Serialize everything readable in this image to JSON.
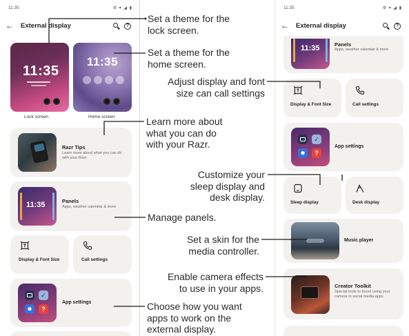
{
  "left_phone": {
    "status_time": "11:35",
    "status_icons": "⚙ ▾ ◢ ▮",
    "title": "External display",
    "lock_screen": {
      "clock": "11:35",
      "label": "Lock screen"
    },
    "home_screen": {
      "clock": "11:35",
      "label": "Home screen"
    },
    "razr_tips": {
      "title": "Razr Tips",
      "subtitle": "Learn more about what you can do with your Razr"
    },
    "panels": {
      "title": "Panels",
      "subtitle": "Apps, weather calendar & more",
      "clock": "11:35"
    },
    "display_font": {
      "label": "Display & Font Size"
    },
    "call_settings": {
      "label": "Call settings"
    },
    "app_settings": {
      "label": "App settings"
    }
  },
  "right_phone": {
    "status_time": "11:35",
    "status_icons": "⚙ ▾ ◢ ▮",
    "title": "External display",
    "panels": {
      "title": "Panels",
      "subtitle": "Apps, weather calendar & more",
      "clock": "11:35"
    },
    "display_font": {
      "label": "Display & Font Size"
    },
    "call_settings": {
      "label": "Call settings"
    },
    "app_settings": {
      "label": "App settings"
    },
    "sleep_display": {
      "label": "Sleep display"
    },
    "desk_display": {
      "label": "Desk display"
    },
    "music_player": {
      "label": "Music player"
    },
    "creator_toolkit": {
      "title": "Creator Toolkit",
      "subtitle": "Special tools to boost using your camera in social media apps"
    }
  },
  "annotations": {
    "lock_theme": "Set a theme for the\nlock screen.",
    "home_theme": "Set a theme for the\nhome screen.",
    "display_font": "Adjust display and font\nsize can call settings",
    "learn_more": "Learn more about\nwhat you can do\nwith your Razr.",
    "sleep_desk": "Customize your\nsleep display and\ndesk display.",
    "manage_panels": "Manage panels.",
    "skin_media": "Set a skin for the\nmedia controller.",
    "camera_effects": "Enable camera effects\nto use in your apps.",
    "apps_work": "Choose how you want\napps to work on the\nexternal display."
  }
}
